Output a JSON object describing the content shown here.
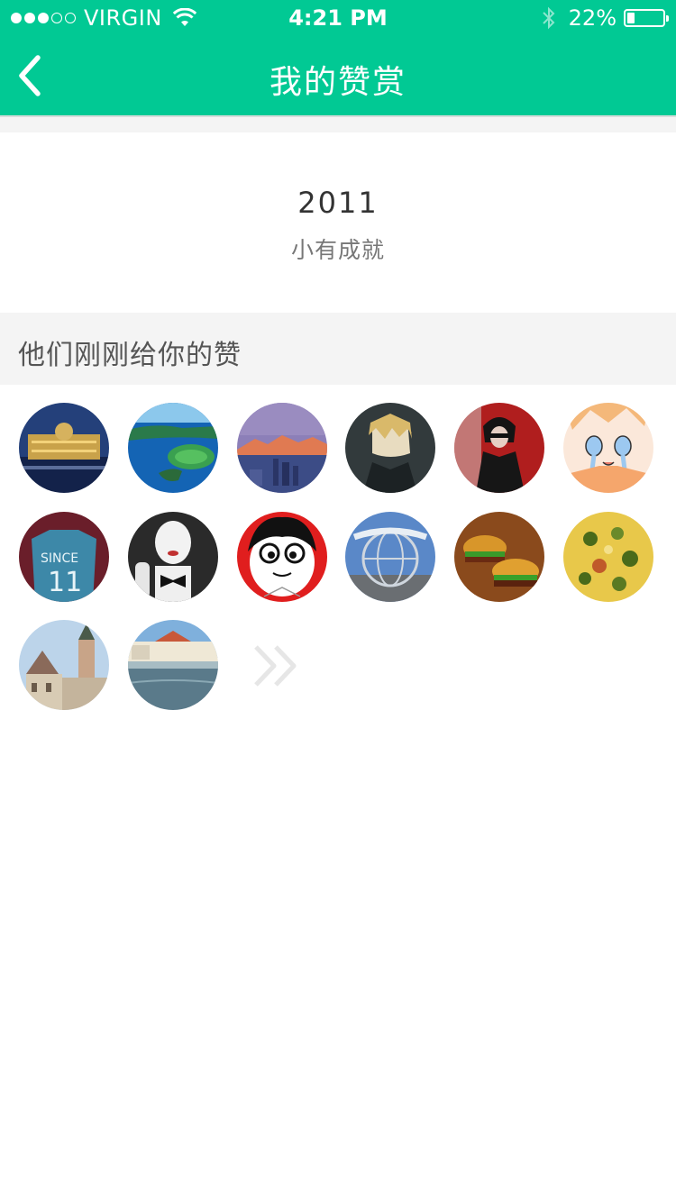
{
  "status_bar": {
    "carrier": "VIRGIN",
    "time": "4:21 PM",
    "battery_percent": "22%",
    "battery_level": 0.22,
    "signal_bars_filled": 3,
    "signal_bars_total": 5
  },
  "nav": {
    "title": "我的赞赏",
    "back_icon": "chevron-left-icon"
  },
  "summary": {
    "year": "2011",
    "rank": "小有成就"
  },
  "likes_section": {
    "title": "他们刚刚给你的赞",
    "avatars": [
      {
        "id": "palace-night"
      },
      {
        "id": "island-aerial"
      },
      {
        "id": "city-sunset"
      },
      {
        "id": "anime-blond"
      },
      {
        "id": "woman-black-coat"
      },
      {
        "id": "cartoon-crying"
      },
      {
        "id": "jersey-shirt"
      },
      {
        "id": "mime-bowtie"
      },
      {
        "id": "cartoon-face-red"
      },
      {
        "id": "universal-globe"
      },
      {
        "id": "burgers"
      },
      {
        "id": "pizza"
      },
      {
        "id": "town-hall"
      },
      {
        "id": "palace-lake"
      }
    ],
    "more_icon": "double-chevron-right-icon"
  },
  "colors": {
    "brand_green": "#01c994",
    "section_bg": "#f4f4f4",
    "text_dark": "#333333",
    "text_muted": "#777777"
  }
}
